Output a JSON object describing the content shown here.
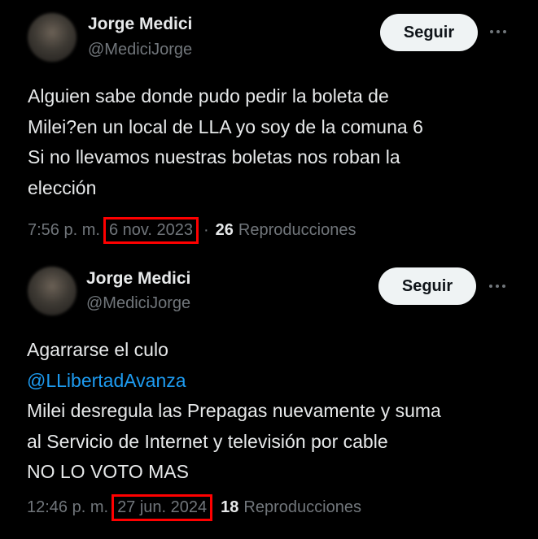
{
  "tweets": [
    {
      "author_name": "Jorge Medici",
      "author_handle": "@MediciJorge",
      "follow_label": "Seguir",
      "more_icon": "more-horizontal-icon",
      "lines": [
        "Alguien sabe donde pudo pedir la boleta de",
        "Milei?en un local de LLA yo soy de la comuna 6",
        "Si no llevamos nuestras boletas nos roban la",
        "elección"
      ],
      "time": "7:56 p. m.",
      "date": "6 nov. 2023",
      "separator": "·",
      "views_count": "26",
      "views_label": "Reproducciones"
    },
    {
      "author_name": "Jorge Medici",
      "author_handle": "@MediciJorge",
      "follow_label": "Seguir",
      "more_icon": "more-horizontal-icon",
      "lines": [
        "Agarrarse el culo",
        "@LLibertadAvanza",
        "Milei desregula las Prepagas nuevamente y suma",
        "al Servicio de Internet y televisión por cable",
        "NO LO VOTO MAS"
      ],
      "time": "12:46 p. m.",
      "date": "27 jun. 2024",
      "separator": "·",
      "views_count": "18",
      "views_label": "Reproducciones"
    }
  ],
  "colors": {
    "background": "#000000",
    "text": "#e7e9ea",
    "secondary": "#71767b",
    "mention": "#1d9bf0",
    "follow_bg": "#eff3f4",
    "highlight_box": "#ff0000"
  }
}
